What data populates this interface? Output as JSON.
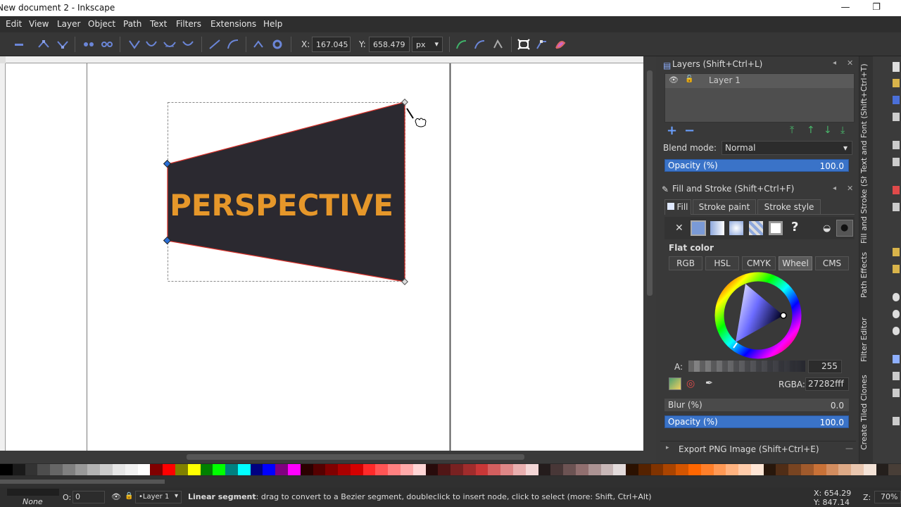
{
  "window": {
    "title": "New document 2 - Inkscape",
    "minimize": "—",
    "maximize": "❐"
  },
  "menu": [
    "Edit",
    "View",
    "Layer",
    "Object",
    "Path",
    "Text",
    "Filters",
    "Extensions",
    "Help"
  ],
  "toolbar": {
    "x_label": "X:",
    "x_value": "167.045",
    "y_label": "Y:",
    "y_value": "658.479",
    "unit": "px"
  },
  "canvas": {
    "artwork_text": "PERSPECTIVE",
    "shape_fill": "#2b2930",
    "shape_stroke": "#d8322b",
    "text_color": "#e6972a"
  },
  "layers_panel": {
    "title": "Layers (Shift+Ctrl+L)",
    "layer_name": "Layer 1",
    "blend_label": "Blend mode:",
    "blend_value": "Normal",
    "opacity_label": "Opacity (%)",
    "opacity_value": "100.0"
  },
  "fill_stroke_panel": {
    "title": "Fill and Stroke (Shift+Ctrl+F)",
    "tabs": [
      "Fill",
      "Stroke paint",
      "Stroke style"
    ],
    "flat_color_label": "Flat color",
    "modes": [
      "RGB",
      "HSL",
      "CMYK",
      "Wheel",
      "CMS"
    ],
    "alpha_label": "A:",
    "alpha_value": "255",
    "rgba_label": "RGBA:",
    "rgba_value": "27282fff",
    "blur_label": "Blur (%)",
    "blur_value": "0.0",
    "opacity_label": "Opacity (%)",
    "opacity_value": "100.0"
  },
  "export_panel": {
    "title": "Export PNG Image (Shift+Ctrl+E)"
  },
  "side_tabs": [
    "Text and Font (Shift+Ctrl+T)",
    "Fill and Stroke (Shift+Ctrl+F)",
    "Path Effects",
    "Filter Editor",
    "Create Tiled Clones"
  ],
  "statusbar": {
    "fill_value": "None",
    "opacity_label": "O:",
    "opacity_value": "0",
    "layer_name": "•Layer 1",
    "message_bold": "Linear segment",
    "message_rest": ": drag to convert to a Bezier segment, doubleclick to insert node, click to select (more: Shift, Ctrl+Alt)",
    "x_coord": "X: 654.29",
    "y_coord": "Y: 847.14",
    "zoom_label": "Z:",
    "zoom_value": "70%"
  },
  "palette": [
    "#000000",
    "#1a1a1a",
    "#333333",
    "#4d4d4d",
    "#666666",
    "#808080",
    "#999999",
    "#b3b3b3",
    "#cccccc",
    "#e6e6e6",
    "#f2f2f2",
    "#ffffff",
    "#800000",
    "#ff0000",
    "#808000",
    "#ffff00",
    "#008000",
    "#00ff00",
    "#008080",
    "#00ffff",
    "#000080",
    "#0000ff",
    "#800080",
    "#ff00ff",
    "#2b0000",
    "#550000",
    "#800000",
    "#aa0000",
    "#d40000",
    "#ff2a2a",
    "#ff5555",
    "#ff8080",
    "#ffaaaa",
    "#ffd5d5",
    "#280b0b",
    "#501616",
    "#782121",
    "#a02c2c",
    "#c83737",
    "#d35f5f",
    "#de8787",
    "#e9afaf",
    "#f4d7d7",
    "#241c1c",
    "#483737",
    "#6c5353",
    "#916f6f",
    "#ac9393",
    "#c8b7b7",
    "#e3dbdb",
    "#2b1100",
    "#552200",
    "#803300",
    "#aa4400",
    "#d45500",
    "#ff6600",
    "#ff7f2a",
    "#ff9955",
    "#ffb380",
    "#ffccaa",
    "#ffe6d5",
    "#28170b",
    "#502d16",
    "#784421",
    "#a05a2c",
    "#c87137",
    "#d38d5f",
    "#deaa87",
    "#e9c6af",
    "#f4e3d7",
    "#241f1c",
    "#483e37"
  ]
}
